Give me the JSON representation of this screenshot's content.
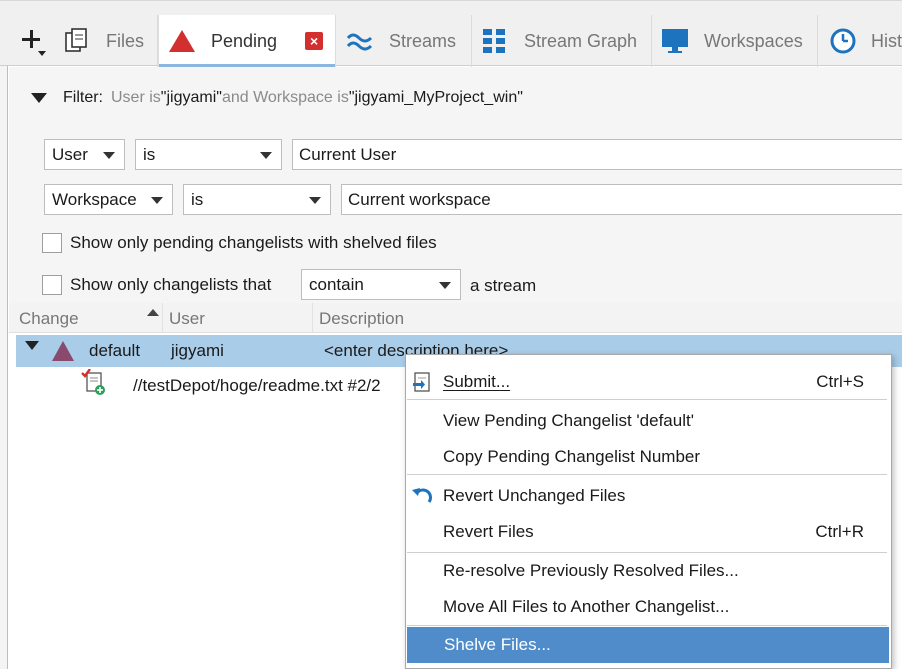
{
  "tabs": [
    {
      "label": "Files",
      "icon": "files-icon"
    },
    {
      "label": "Pending",
      "icon": "pending-triangle-icon",
      "active": true
    },
    {
      "label": "Streams",
      "icon": "streams-icon"
    },
    {
      "label": "Stream Graph",
      "icon": "stream-graph-icon"
    },
    {
      "label": "Workspaces",
      "icon": "workspaces-icon"
    },
    {
      "label": "Hist",
      "icon": "history-clock-icon"
    }
  ],
  "filter": {
    "label": "Filter:",
    "summary_pre": "User is ",
    "summary_user": "\"jigyami\"",
    "summary_mid": " and Workspace is ",
    "summary_ws": "\"jigyami_MyProject_win\"",
    "row1": {
      "field": "User",
      "op": "is",
      "value": "Current User"
    },
    "row2": {
      "field": "Workspace",
      "op": "is",
      "value": "Current workspace"
    },
    "shelved_checkbox": "Show only pending changelists with shelved files",
    "stream_checkbox_pre": "Show only changelists that",
    "stream_op": "contain",
    "stream_checkbox_post": "a stream"
  },
  "list": {
    "columns": [
      "Change",
      "User",
      "Description"
    ],
    "rows": [
      {
        "change": "default",
        "user": "jigyami",
        "description": "<enter description here>"
      }
    ],
    "files": [
      {
        "path": "//testDepot/hoge/readme.txt #2/2"
      }
    ]
  },
  "context_menu": {
    "items": [
      {
        "label": "Submit...",
        "shortcut": "Ctrl+S",
        "icon": "submit-icon"
      },
      {
        "label": "View Pending Changelist 'default'"
      },
      {
        "label": "Copy Pending Changelist Number"
      },
      {
        "label": "Revert Unchanged Files",
        "icon": "revert-arrow-icon"
      },
      {
        "label": "Revert Files",
        "shortcut": "Ctrl+R"
      },
      {
        "label": "Re-resolve Previously Resolved Files..."
      },
      {
        "label": "Move All Files to Another Changelist..."
      },
      {
        "label": "Shelve Files...",
        "highlighted": true
      }
    ]
  },
  "colors": {
    "accent": "#4f8cc9",
    "selection": "#a9cce8",
    "pending_red": "#d32f2f",
    "tab_icon_blue": "#1e73be"
  }
}
